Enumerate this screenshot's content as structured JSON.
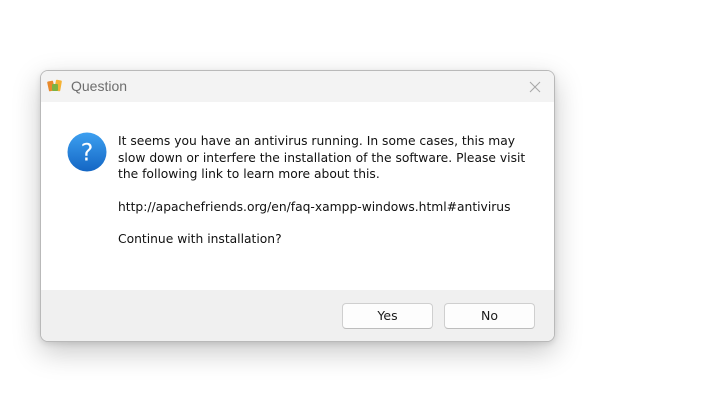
{
  "dialog": {
    "title": "Question",
    "icon": "xampp-app-icon",
    "close_icon": "close-icon",
    "message_icon": "question-icon",
    "message_lines": [
      "It seems you have an antivirus running. In some cases, this may slow down or interfere the installation of the software. Please visit the following link to learn more about this."
    ],
    "link_text": "http://apachefriends.org/en/faq-xampp-windows.html#antivirus",
    "question": "Continue with installation?",
    "buttons": {
      "yes_label": "Yes",
      "no_label": "No"
    }
  },
  "colors": {
    "titlebar_bg": "#f3f3f3",
    "footer_bg": "#f0f0f0",
    "question_icon_blue": "#1f7fd6",
    "title_text": "#6e6e6e"
  }
}
